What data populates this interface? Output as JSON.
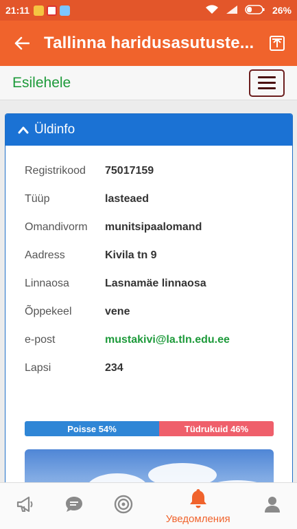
{
  "status_bar": {
    "time": "21:11",
    "battery": "26%"
  },
  "app_bar": {
    "title": "Tallinna haridusasutuste..."
  },
  "web_header": {
    "home_link": "Esilehele"
  },
  "card": {
    "header": "Üldinfo",
    "rows": [
      {
        "label": "Registrikood",
        "value": "75017159"
      },
      {
        "label": "Tüüp",
        "value": "lasteaed"
      },
      {
        "label": "Omandivorm",
        "value": "munitsipaalomand"
      },
      {
        "label": "Aadress",
        "value": "Kivila tn 9"
      },
      {
        "label": "Linnaosa",
        "value": "Lasnamäe linnaosa"
      },
      {
        "label": "Õppekeel",
        "value": "vene"
      },
      {
        "label": "e-post",
        "value": "mustakivi@la.tln.edu.ee"
      },
      {
        "label": "Lapsi",
        "value": "234"
      }
    ],
    "gender": {
      "boys_label": "Poisse  54%",
      "girls_label": "Tüdrukuid  46%",
      "boys_percent": 54,
      "girls_percent": 46,
      "boys_color": "#2f86d6",
      "girls_color": "#ef5f6b"
    }
  },
  "bottom_nav": {
    "items": [
      {
        "icon": "megaphone-icon"
      },
      {
        "icon": "chat-bubble-icon"
      },
      {
        "icon": "target-icon"
      },
      {
        "icon": "bell-icon",
        "label": "Уведомления",
        "active": true
      },
      {
        "icon": "user-icon"
      }
    ]
  },
  "colors": {
    "accent": "#f0632c",
    "primary": "#1b72d4",
    "link": "#1d9a3a"
  }
}
